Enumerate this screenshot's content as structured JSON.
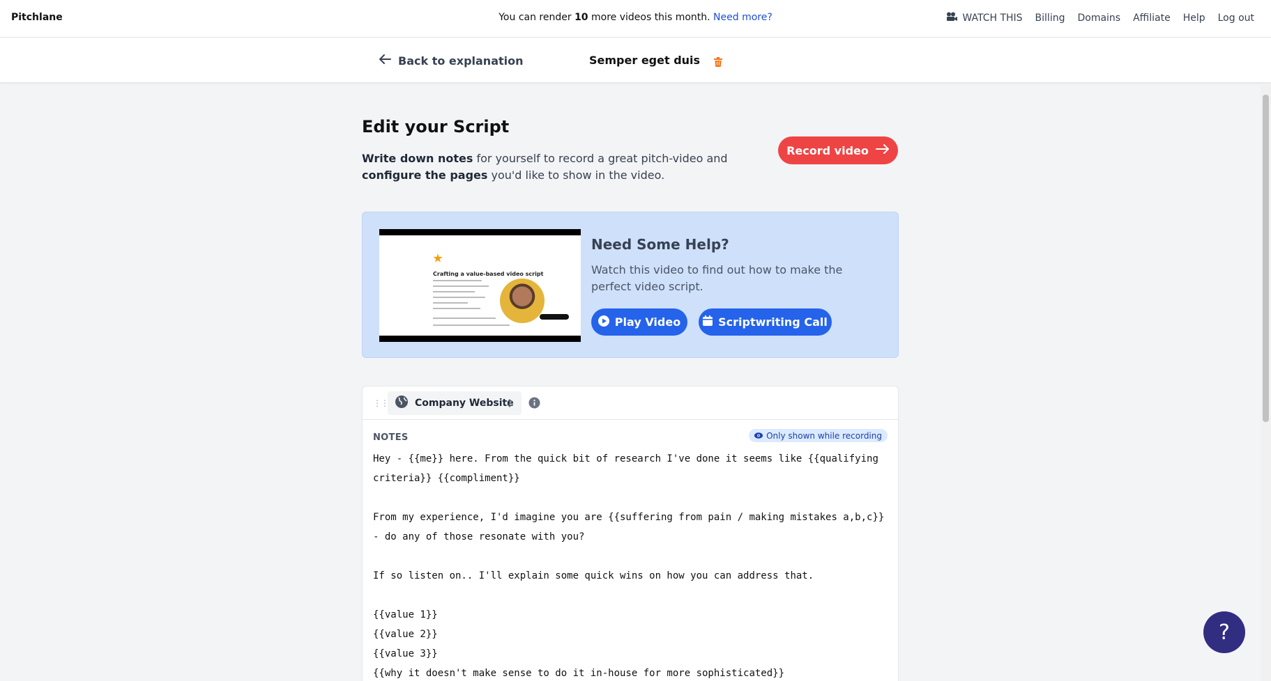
{
  "topbar": {
    "brand": "Pitchlane",
    "quota_prefix": "You can render ",
    "quota_count": "10",
    "quota_suffix": " more videos this month. ",
    "quota_link": "Need more?",
    "nav": {
      "watch": "WATCH THIS",
      "billing": "Billing",
      "domains": "Domains",
      "affiliate": "Affiliate",
      "help": "Help",
      "logout": "Log out"
    }
  },
  "subbar": {
    "back": "Back to explanation",
    "title": "Semper eget duis"
  },
  "page": {
    "title": "Edit your Script",
    "intro_b1": "Write down notes",
    "intro_t1": " for yourself to record a great pitch-video and ",
    "intro_b2": "configure the pages",
    "intro_t2": " you'd like to show in the video.",
    "record_button": "Record video"
  },
  "help": {
    "title": "Need Some Help?",
    "text": "Watch this video to find out how to make the perfect video script.",
    "play_button": "Play Video",
    "call_button": "Scriptwriting Call",
    "thumbnail_title": "Crafting a value-based video script"
  },
  "card": {
    "page_select": "Company Website",
    "notes_label": "NOTES",
    "badge": "Only shown while recording",
    "notes_text": "Hey - {{me}} here. From the quick bit of research I've done it seems like {{qualifying criteria}} {{compliment}}\n\nFrom my experience, I'd imagine you are {{suffering from pain / making mistakes a,b,c}} - do any of those resonate with you?\n\nIf so listen on.. I'll explain some quick wins on how you can address that.\n\n{{value 1}}\n{{value 2}}\n{{value 3}}\n{{why it doesn't make sense to do it in-house for more sophisticated}}"
  },
  "fab": {
    "label": "?"
  },
  "colors": {
    "accent_red": "#ef4444",
    "accent_blue": "#2563eb",
    "help_bg": "#cfe0fb",
    "fab": "#312e81"
  }
}
